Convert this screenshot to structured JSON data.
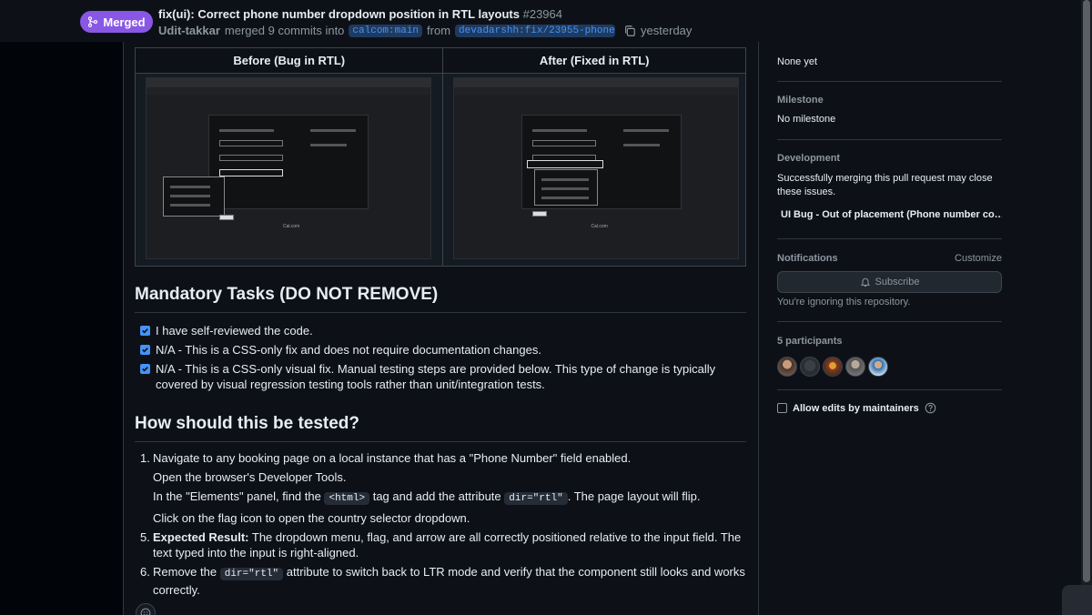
{
  "header": {
    "status": "Merged",
    "title": "fix(ui): Correct phone number dropdown position in RTL layouts",
    "number": "#23964",
    "author": "Udit-takkar",
    "merge_text": "merged 9 commits into",
    "base_branch": "calcom:main",
    "from_text": "from",
    "head_branch": "devadarshh:fix/23955-phone-…",
    "time": "yesterday"
  },
  "comparison": {
    "before_header": "Before (Bug in RTL)",
    "after_header": "After (Fixed in RTL)"
  },
  "mandatory": {
    "heading": "Mandatory Tasks (DO NOT REMOVE)",
    "items": [
      {
        "text": "I have self-reviewed the code.",
        "checked": true
      },
      {
        "text": "N/A - This is a CSS-only fix and does not require documentation changes.",
        "checked": true
      },
      {
        "text": "N/A - This is a CSS-only visual fix. Manual testing steps are provided below. This type of change is typically covered by visual regression testing tools rather than unit/integration tests.",
        "checked": true
      }
    ]
  },
  "testing": {
    "heading": "How should this be tested?",
    "steps": [
      {
        "num": "1.",
        "text": "Navigate to any booking page on a local instance that has a \"Phone Number\" field enabled."
      },
      {
        "num": "",
        "text": "Open the browser's Developer Tools."
      },
      {
        "num": "",
        "pre": "In the \"Elements\" panel, find the",
        "code": "<html>",
        "mid": "tag and add the attribute",
        "code2": "dir=\"rtl\"",
        "post": ". The page layout will flip."
      },
      {
        "num": "",
        "text": "Click on the flag icon to open the country selector dropdown."
      },
      {
        "num": "5.",
        "bold": "Expected Result:",
        "text": "The dropdown menu, flag, and arrow are all correctly positioned relative to the input field. The text typed into the input is right-aligned."
      },
      {
        "num": "6.",
        "pre": "Remove the",
        "code": "dir=\"rtl\"",
        "post": "attribute to switch back to LTR mode and verify that the component still looks and works correctly."
      }
    ]
  },
  "sidebar": {
    "projects_value": "None yet",
    "milestone_label": "Milestone",
    "milestone_value": "No milestone",
    "development_label": "Development",
    "development_text": "Successfully merging this pull request may close these issues.",
    "linked_issue": "UI Bug - Out of placement (Phone number co…",
    "notifications_label": "Notifications",
    "customize": "Customize",
    "subscribe": "Subscribe",
    "ignoring": "You're ignoring this repository.",
    "participants_label": "5 participants",
    "allow_edits": "Allow edits by maintainers"
  },
  "colors": {
    "merged": "#8957e5",
    "link": "#4493f8",
    "bg": "#0d1117"
  }
}
